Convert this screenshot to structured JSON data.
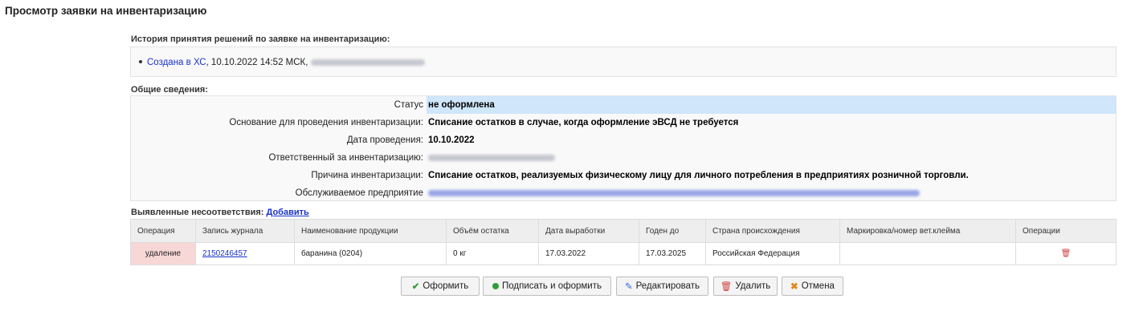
{
  "page": {
    "title": "Просмотр заявки на инвентаризацию"
  },
  "history": {
    "label": "История принятия решений по заявке на инвентаризацию:",
    "items": [
      {
        "link": "Создана в ХС",
        "text": ", 10.10.2022 14:52 МСК, "
      }
    ]
  },
  "general": {
    "label": "Общие сведения:",
    "rows": [
      {
        "label": "Статус",
        "value": "не оформлена"
      },
      {
        "label": "Основание для проведения инвентаризации:",
        "value": "Списание остатков в случае, когда оформление эВСД не требуется"
      },
      {
        "label": "Дата проведения:",
        "value": "10.10.2022"
      },
      {
        "label": "Ответственный за инвентаризацию:",
        "value": ""
      },
      {
        "label": "Причина инвентаризации:",
        "value": "Списание остатков, реализуемых физическому лицу для личного потребления в предприятиях розничной торговли."
      },
      {
        "label": "Обслуживаемое предприятие",
        "value": ""
      }
    ]
  },
  "discrepancies": {
    "label": "Выявленные несоответствия:",
    "add_link": "Добавить",
    "columns": [
      "Операция",
      "Запись журнала",
      "Наименование продукции",
      "Объём остатка",
      "Дата выработки",
      "Годен до",
      "Страна происхождения",
      "Маркировка/номер вет.клейма",
      "Операции"
    ],
    "rows": [
      {
        "operation": "удаление",
        "record": "2150246457",
        "product": "баранина (0204)",
        "volume": "0 кг",
        "produced": "17.03.2022",
        "expires": "17.03.2025",
        "country": "Российская Федерация",
        "marking": ""
      }
    ]
  },
  "actions": {
    "submit": "Оформить",
    "sign_submit": "Подписать и оформить",
    "edit": "Редактировать",
    "delete": "Удалить",
    "cancel": "Отмена"
  },
  "colors": {
    "status_highlight": "#cfe6fb",
    "delete_row": "#f8d7d7",
    "link": "#1a33cc"
  }
}
